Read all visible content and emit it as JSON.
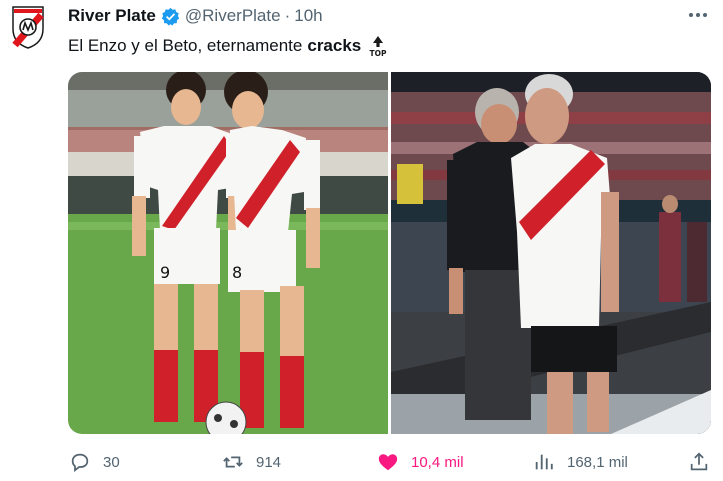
{
  "tweet": {
    "author_name": "River Plate",
    "handle": "@RiverPlate",
    "separator": "·",
    "time": "10h",
    "text_prefix": "El Enzo y el Beto, eternamente",
    "text_bold": "cracks",
    "emoji": "top-arrow-icon"
  },
  "media": {
    "left_photo": "Two River Plate players in white shirts with red sash, numbers 9 and 8, on a stadium pitch",
    "right_photo": "Two older men, one in a black shirt and one in a River Plate jersey, standing pitch-side in a stadium"
  },
  "actions": {
    "replies": "30",
    "reposts": "914",
    "likes": "10,4 mil",
    "views": "168,1 mil"
  },
  "colors": {
    "text": "#0f1419",
    "secondary": "#536471",
    "like": "#f91880",
    "verified": "#1d9bf0",
    "club_red": "#e1161d"
  }
}
